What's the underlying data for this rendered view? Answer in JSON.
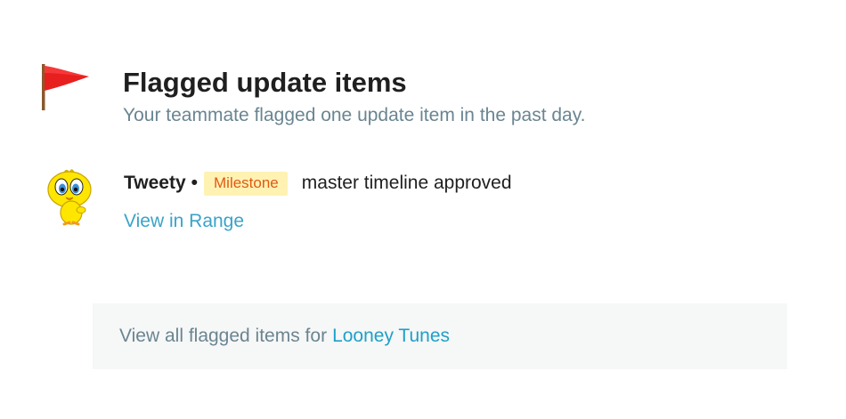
{
  "header": {
    "icon": "red-flag-icon",
    "title": "Flagged update items",
    "subtitle": "Your teammate flagged one update item in the past day."
  },
  "item": {
    "avatar": "tweety-avatar",
    "author": "Tweety",
    "separator": "•",
    "badge": "Milestone",
    "text": "master timeline approved",
    "link": "View in Range"
  },
  "footer": {
    "text": "View all flagged items for",
    "link": "Looney Tunes"
  },
  "colors": {
    "flag": "#e81f1f",
    "badge_background": "#fff2b3",
    "badge_text": "#e05a12",
    "link": "#3aa3c8",
    "muted_text": "#6a8591"
  }
}
